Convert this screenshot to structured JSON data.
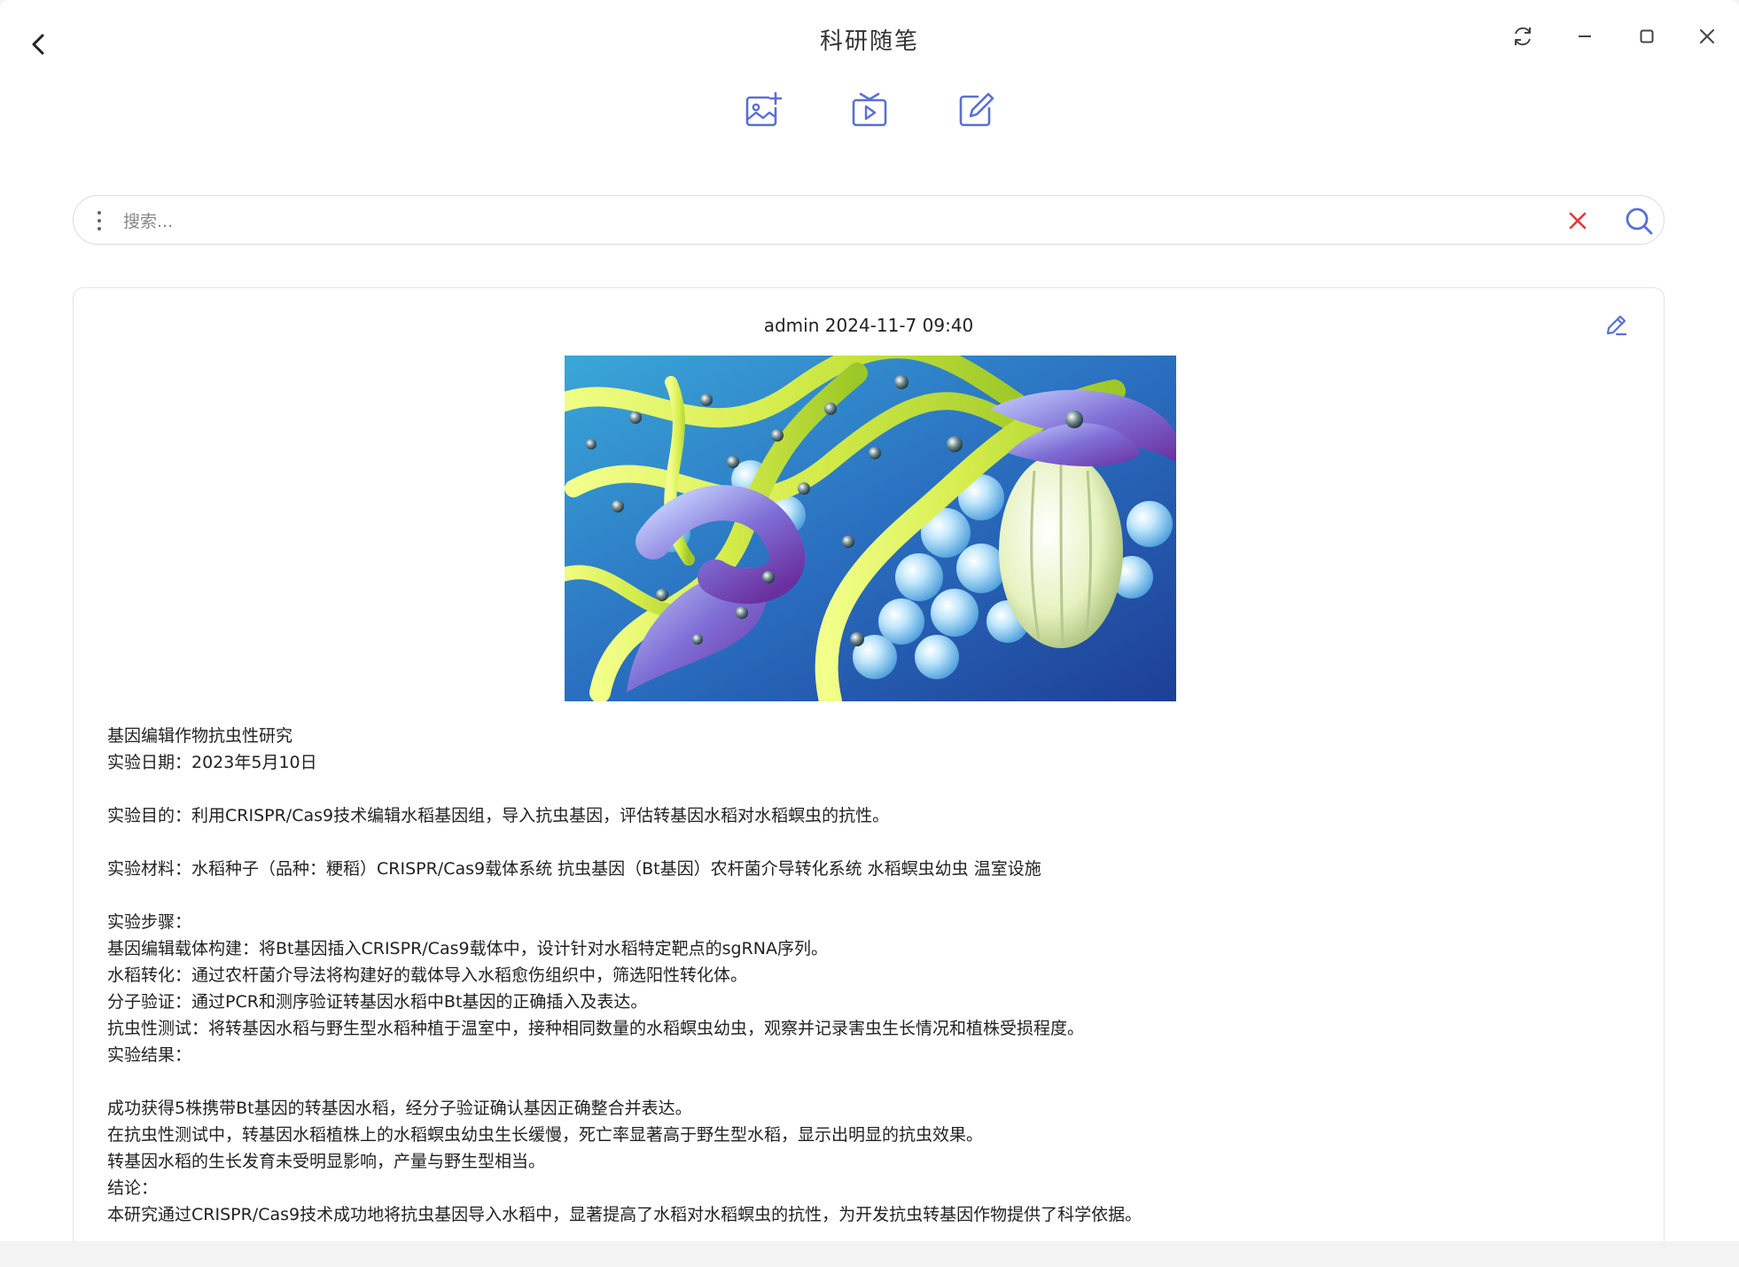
{
  "app": {
    "title": "科研随笔"
  },
  "search": {
    "placeholder": "搜索...",
    "value": ""
  },
  "note": {
    "author": "admin",
    "datetime": "2024-11-7 09:40",
    "lines": [
      "基因编辑作物抗虫性研究",
      "实验日期：2023年5月10日",
      "",
      "实验目的：利用CRISPR/Cas9技术编辑水稻基因组，导入抗虫基因，评估转基因水稻对水稻螟虫的抗性。",
      "",
      "实验材料：水稻种子（品种：粳稻）CRISPR/Cas9载体系统 抗虫基因（Bt基因）农杆菌介导转化系统 水稻螟虫幼虫 温室设施",
      "",
      "实验步骤：",
      "基因编辑载体构建：将Bt基因插入CRISPR/Cas9载体中，设计针对水稻特定靶点的sgRNA序列。",
      "水稻转化：通过农杆菌介导法将构建好的载体导入水稻愈伤组织中，筛选阳性转化体。",
      "分子验证：通过PCR和测序验证转基因水稻中Bt基因的正确插入及表达。",
      "抗虫性测试：将转基因水稻与野生型水稻种植于温室中，接种相同数量的水稻螟虫幼虫，观察并记录害虫生长情况和植株受损程度。",
      "实验结果：",
      "",
      "成功获得5株携带Bt基因的转基因水稻，经分子验证确认基因正确整合并表达。",
      "在抗虫性测试中，转基因水稻植株上的水稻螟虫幼虫生长缓慢，死亡率显著高于野生型水稻，显示出明显的抗虫效果。",
      "转基因水稻的生长发育未受明显影响，产量与野生型相当。",
      "结论：",
      "本研究通过CRISPR/Cas9技术成功地将抗虫基因导入水稻中，显著提高了水稻对水稻螟虫的抗性，为开发抗虫转基因作物提供了科学依据。"
    ]
  },
  "icons": {
    "back": "chevron-left-icon",
    "refresh": "refresh-icon",
    "minimize": "minimize-icon",
    "maximize": "maximize-icon",
    "close": "close-icon",
    "add_image": "add-image-icon",
    "add_video": "add-video-icon",
    "new_note": "edit-note-icon",
    "search_menu": "more-vertical-icon",
    "search_clear": "clear-icon",
    "search": "search-icon",
    "note_edit": "pencil-icon"
  },
  "colors": {
    "accent": "#5b6fd6",
    "clear": "#e53935",
    "background": "#ffffff",
    "text": "#222222"
  }
}
